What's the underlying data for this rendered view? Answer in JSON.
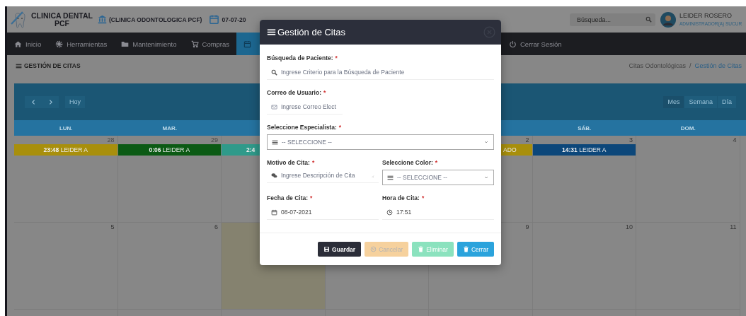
{
  "header": {
    "brand": [
      "CLINICA DENTAL",
      "PCF"
    ],
    "branch": "(CLINICA ODONTOLOGICA PCF)",
    "date": "07-07-20",
    "search": {
      "placeholder": "Búsqueda..."
    },
    "user": {
      "name": "LEIDER ROSERO",
      "role": "ADMINISTRADOR(A) SUCUR"
    }
  },
  "nav": [
    {
      "kind": "home",
      "label": "Inicio",
      "selected": false
    },
    {
      "kind": "gear",
      "label": "Herramientas",
      "selected": false
    },
    {
      "kind": "folder",
      "label": "Mantenimiento",
      "selected": false
    },
    {
      "kind": "cart",
      "label": "Compras",
      "selected": false
    },
    {
      "kind": "calendar",
      "selected": true
    }
  ],
  "logout": {
    "label": "Cerrar Sesión"
  },
  "page": {
    "title": "GESTIÓN DE CITAS",
    "breadcrumb": [
      {
        "label": "Citas Odontológicas",
        "selected": false
      },
      {
        "label": "Gestión de Citas",
        "selected": true
      }
    ],
    "separator": "/"
  },
  "calendar": {
    "today_label": "Hoy",
    "views": [
      {
        "label": "Mes",
        "selected": true
      },
      {
        "label": "Semana",
        "selected": false
      },
      {
        "label": "Día",
        "selected": false
      }
    ],
    "day_headers_left": [
      "LUN.",
      "MAR."
    ],
    "day_headers_right": [
      "SÁB.",
      "DOM."
    ],
    "weeks": [
      {
        "days": [
          {
            "kind": "day",
            "date": "28",
            "other_month": true,
            "today": false,
            "events": [
              {
                "kind": "full",
                "time": "23:48",
                "title": "LEIDER A",
                "color": "#a88f0c"
              }
            ]
          },
          {
            "kind": "day",
            "date": "29",
            "other_month": true,
            "today": false,
            "events": [
              {
                "kind": "full",
                "time": "0:06",
                "title": "LEIDER A",
                "color": "#0b5a14"
              }
            ]
          },
          {
            "kind": "day",
            "today": false,
            "events": [
              {
                "kind": "clipped_right",
                "time": "2:4",
                "color": "#2f9a8a"
              }
            ]
          },
          {
            "kind": "covered"
          },
          {
            "kind": "day",
            "date": "2",
            "other_month": false,
            "today": false,
            "events": [
              {
                "kind": "clipped_left",
                "title": "ADO",
                "color": "#a88f0c"
              }
            ]
          },
          {
            "kind": "day",
            "date": "3",
            "other_month": false,
            "today": false,
            "events": [
              {
                "kind": "full",
                "time": "14:31",
                "title": "LEIDER A",
                "color": "#0c477a"
              }
            ]
          },
          {
            "kind": "day",
            "date": "4",
            "other_month": false,
            "today": false
          }
        ]
      },
      {
        "days": [
          {
            "kind": "day",
            "date": "5",
            "other_month": false,
            "today": false
          },
          {
            "kind": "day",
            "date": "6",
            "other_month": false,
            "today": false
          },
          {
            "kind": "day",
            "today": true
          },
          {
            "kind": "covered"
          },
          {
            "kind": "day",
            "date": "9",
            "other_month": false,
            "today": false
          },
          {
            "kind": "day",
            "date": "10",
            "other_month": false,
            "today": false
          },
          {
            "kind": "day",
            "date": "11",
            "other_month": false,
            "today": false
          }
        ]
      }
    ]
  },
  "modal": {
    "title": "Gestión de Citas",
    "rows": [
      {
        "fields": [
          {
            "kind": "search",
            "label": "Búsqueda de Paciente:",
            "required_mark": "*",
            "placeholder": "Ingrese Criterio para la Búsqueda de Paciente"
          }
        ]
      },
      {
        "fields": [
          {
            "kind": "email",
            "label": "Correo de Usuario:",
            "required_mark": "*",
            "placeholder": "Ingrese Correo Elect"
          }
        ]
      },
      {
        "fields": [
          {
            "kind": "select",
            "label": "Seleccione Especialista:",
            "required_mark": "*",
            "value": "-- SELECCIONE --"
          }
        ]
      },
      {
        "fields": [
          {
            "kind": "textarea",
            "label": "Motivo de Cita:",
            "required_mark": "*",
            "placeholder": "Ingrese Descripción de Cita"
          },
          {
            "kind": "select",
            "label": "Seleccione Color:",
            "required_mark": "*",
            "value": "-- SELECCIONE --"
          }
        ]
      },
      {
        "fields": [
          {
            "kind": "date",
            "label": "Fecha de Cita:",
            "required_mark": "*",
            "value": "08-07-2021"
          },
          {
            "kind": "time",
            "label": "Hora de Cita:",
            "required_mark": "*",
            "value": "17:51"
          }
        ]
      }
    ],
    "buttons": [
      {
        "kind": "save",
        "label": "Guardar",
        "disabled": false
      },
      {
        "kind": "cancel",
        "label": "Cancelar",
        "disabled": true
      },
      {
        "kind": "delete",
        "label": "Eliminar",
        "disabled": true
      },
      {
        "kind": "close",
        "label": "Cerrar",
        "disabled": false
      }
    ]
  }
}
